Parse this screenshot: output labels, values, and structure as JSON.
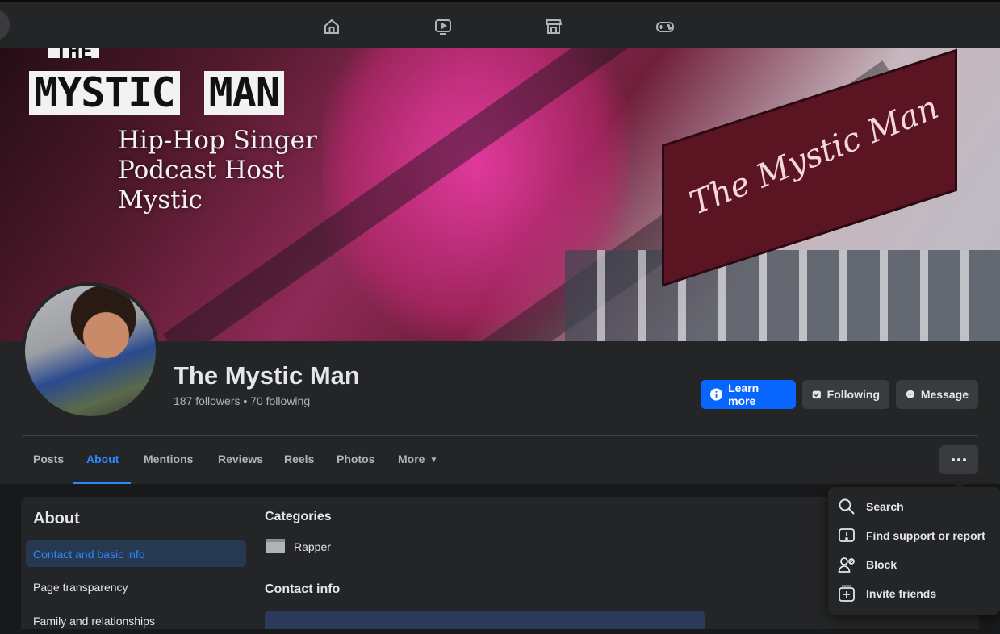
{
  "topnav": {
    "icons": [
      "home-icon",
      "video-icon",
      "marketplace-icon",
      "gaming-icon"
    ]
  },
  "cover": {
    "logo_words": [
      "MYSTIC",
      "MAN"
    ],
    "logo_top": "THE",
    "tagline_lines": [
      "Hip-Hop Singer",
      "Podcast Host",
      "Mystic"
    ],
    "sign_text": "The Mystic Man"
  },
  "profile": {
    "name": "The Mystic Man",
    "stats": "187 followers • 70 following"
  },
  "actions": {
    "learn_more": "Learn more",
    "following": "Following",
    "message": "Message"
  },
  "tabs": [
    "Posts",
    "About",
    "Mentions",
    "Reviews",
    "Reels",
    "Photos",
    "More"
  ],
  "active_tab": "About",
  "about": {
    "title": "About",
    "items": [
      "Contact and basic info",
      "Page transparency",
      "Family and relationships"
    ]
  },
  "content": {
    "categories_title": "Categories",
    "category": "Rapper",
    "contact_title": "Contact info"
  },
  "menu": {
    "items": [
      {
        "label": "Search",
        "icon": "search-icon"
      },
      {
        "label": "Find support or report",
        "icon": "report-icon"
      },
      {
        "label": "Block",
        "icon": "block-user-icon"
      },
      {
        "label": "Invite friends",
        "icon": "invite-icon"
      }
    ]
  },
  "colors": {
    "accent": "#0866ff",
    "link": "#2d88ff",
    "background": "#18191a",
    "surface": "#242526"
  }
}
